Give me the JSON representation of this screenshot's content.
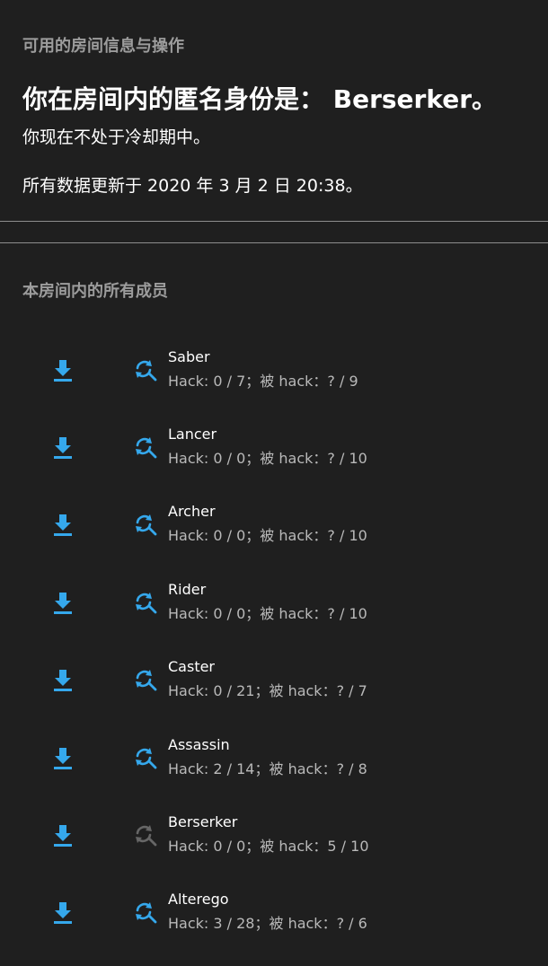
{
  "header": {
    "section_title": "可用的房间信息与操作",
    "identity_text": "你在房间内的匿名身份是： Berserker。",
    "cooldown_text": "你现在不处于冷却期中。",
    "updated_text": "所有数据更新于 2020 年 3 月 2 日 20:38。"
  },
  "members_section": {
    "title": "本房间内的所有成员"
  },
  "colors": {
    "accent": "#35a8ec",
    "disabled": "#666666",
    "background": "#1f1f1f",
    "muted_text": "#9c9c9c"
  },
  "members": [
    {
      "name": "Saber",
      "stats": "Hack: 0 / 7；被 hack：? / 9",
      "hack_enabled": true
    },
    {
      "name": "Lancer",
      "stats": "Hack: 0 / 0；被 hack：? / 10",
      "hack_enabled": true
    },
    {
      "name": "Archer",
      "stats": "Hack: 0 / 0；被 hack：? / 10",
      "hack_enabled": true
    },
    {
      "name": "Rider",
      "stats": "Hack: 0 / 0；被 hack：? / 10",
      "hack_enabled": true
    },
    {
      "name": "Caster",
      "stats": "Hack: 0 / 21；被 hack：? / 7",
      "hack_enabled": true
    },
    {
      "name": "Assassin",
      "stats": "Hack: 2 / 14；被 hack：? / 8",
      "hack_enabled": true
    },
    {
      "name": "Berserker",
      "stats": "Hack: 0 / 0；被 hack：5 / 10",
      "hack_enabled": false
    },
    {
      "name": "Alterego",
      "stats": "Hack: 3 / 28；被 hack：? / 6",
      "hack_enabled": true
    }
  ]
}
